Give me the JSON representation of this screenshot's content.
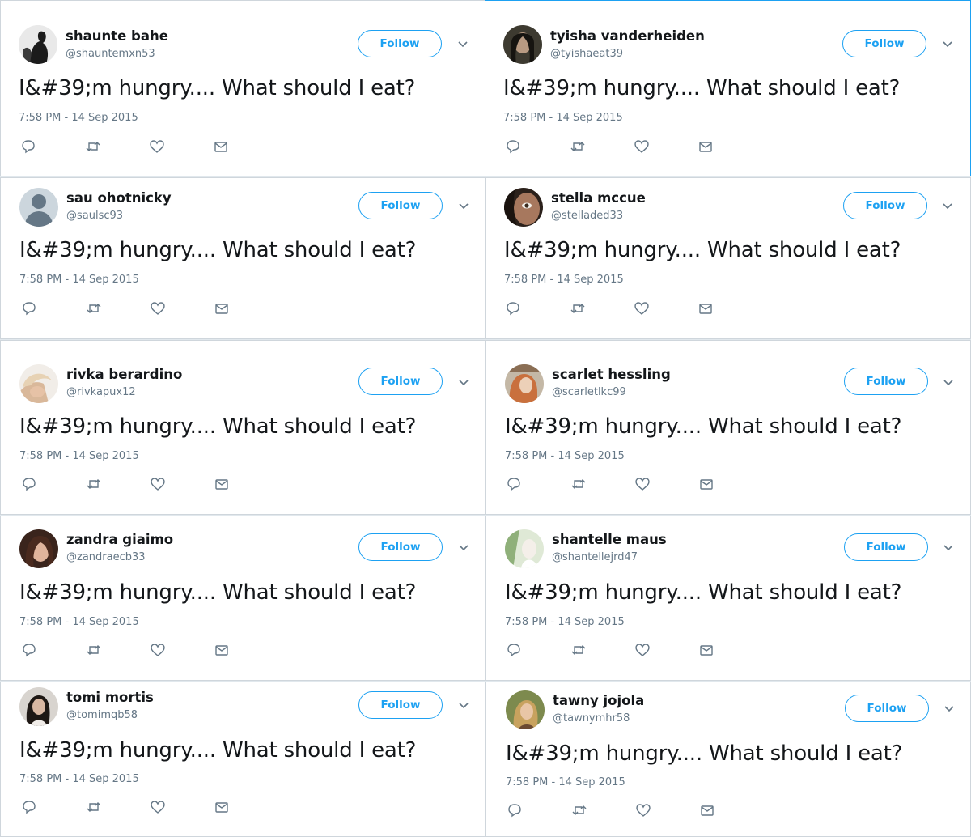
{
  "tweet_text": "I&#39;m hungry.... What should I eat?",
  "timestamp": "7:58 PM - 14 Sep 2015",
  "follow_label": "Follow",
  "colors": {
    "accent": "#1da1f2",
    "text": "#14171a",
    "muted": "#657786"
  },
  "icons": [
    "reply-icon",
    "retweet-icon",
    "like-icon",
    "message-icon",
    "chevron-down-icon"
  ],
  "tweets": [
    {
      "name": "shaunte bahe",
      "handle": "@shauntemxn53",
      "avatar": "photo"
    },
    {
      "name": "tyisha vanderheiden",
      "handle": "@tyishaeat39",
      "avatar": "photo"
    },
    {
      "name": "sau ohotnicky",
      "handle": "@saulsc93",
      "avatar": "default"
    },
    {
      "name": "stella mccue",
      "handle": "@stelladed33",
      "avatar": "photo"
    },
    {
      "name": "rivka berardino",
      "handle": "@rivkapux12",
      "avatar": "photo"
    },
    {
      "name": "scarlet hessling",
      "handle": "@scarletlkc99",
      "avatar": "photo"
    },
    {
      "name": "zandra giaimo",
      "handle": "@zandraecb33",
      "avatar": "photo"
    },
    {
      "name": "shantelle maus",
      "handle": "@shantellejrd47",
      "avatar": "photo"
    },
    {
      "name": "tomi mortis",
      "handle": "@tomimqb58",
      "avatar": "photo"
    },
    {
      "name": "tawny jojola",
      "handle": "@tawnymhr58",
      "avatar": "photo"
    }
  ]
}
